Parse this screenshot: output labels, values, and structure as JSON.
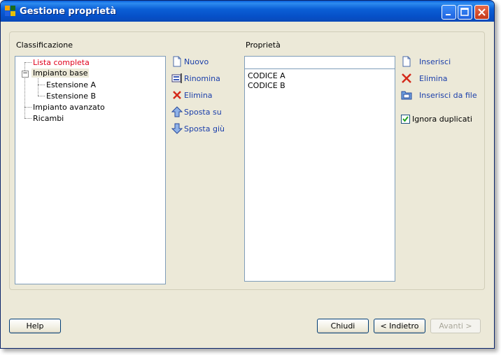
{
  "window": {
    "title": "Gestione proprietà"
  },
  "classification": {
    "label": "Classificazione",
    "tree": [
      {
        "label": "Lista completa",
        "color": "#e0001b"
      },
      {
        "label": "Impianto base",
        "expander": "−"
      },
      {
        "label": "Estensione A"
      },
      {
        "label": "Estensione B"
      },
      {
        "label": "Impianto avanzato"
      },
      {
        "label": "Ricambi"
      }
    ]
  },
  "tree_actions": {
    "new": "Nuovo",
    "rename": "Rinomina",
    "delete": "Elimina",
    "move_up": "Sposta su",
    "move_down": "Sposta giù"
  },
  "properties": {
    "label": "Proprietà",
    "input_value": "",
    "items": [
      "CODICE A",
      "CODICE B"
    ]
  },
  "property_actions": {
    "insert": "Inserisci",
    "delete": "Elimina",
    "insert_from_file": "Inserisci da file",
    "ignore_duplicates_label": "Ignora duplicati",
    "ignore_duplicates_checked": true
  },
  "footer": {
    "help": "Help",
    "close": "Chiudi",
    "back": "< Indietro",
    "next": "Avanti >"
  },
  "colors": {
    "link": "#1a3eaa",
    "selected_tree": "#e0001b",
    "delete_red": "#d42a1a"
  }
}
